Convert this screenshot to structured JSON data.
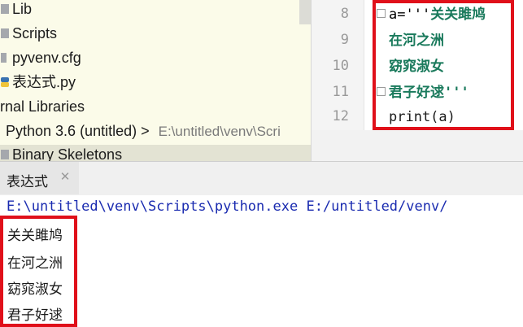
{
  "project_tree": {
    "items": [
      {
        "label": "Lib",
        "icon": "folder-icon"
      },
      {
        "label": "Scripts",
        "icon": "folder-icon"
      },
      {
        "label": "pyvenv.cfg",
        "icon": "file-icon"
      },
      {
        "label": "表达式.py",
        "icon": "python-file-icon"
      },
      {
        "label": "rnal Libraries",
        "icon": "none"
      },
      {
        "label": "Python 3.6 (untitled) >",
        "hint": "E:\\untitled\\venv\\Scri"
      },
      {
        "label": "Binary Skeletons",
        "icon": "folder-icon"
      }
    ]
  },
  "editor": {
    "line_numbers": [
      "8",
      "9",
      "10",
      "11",
      "12"
    ],
    "lines": [
      {
        "prefix": "a='''",
        "string": "关关雎鸠"
      },
      {
        "prefix": "",
        "string": "在河之洲"
      },
      {
        "prefix": "",
        "string": "窈窕淑女"
      },
      {
        "prefix": "",
        "string": "君子好逑",
        "suffix": "'''"
      },
      {
        "prefix": "print(a)",
        "string": ""
      }
    ]
  },
  "run_panel": {
    "tab_label": "表达式",
    "command": "E:\\untitled\\venv\\Scripts\\python.exe E:/untitled/venv/",
    "output": [
      "关关雎鸠",
      "在河之洲",
      "窈窕淑女",
      "君子好逑"
    ]
  },
  "colors": {
    "highlight_box": "#e0101a",
    "string_literal": "#1a7a5c",
    "command_text": "#1a2bb0",
    "tree_background": "#fbfbe9"
  }
}
